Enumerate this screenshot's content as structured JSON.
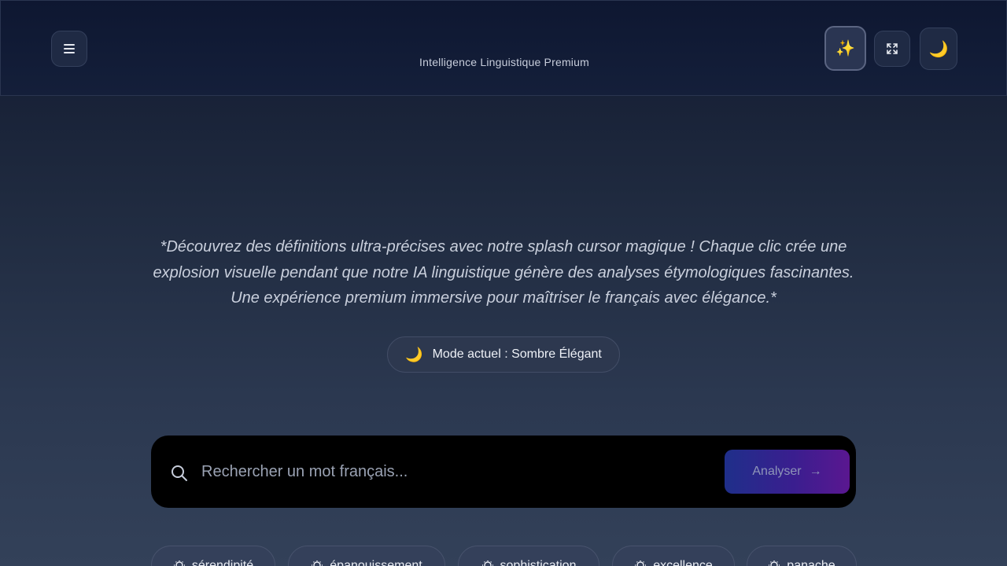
{
  "header": {
    "subtitle": "Intelligence Linguistique Premium",
    "sparkle_icon": "✨",
    "moon_icon": "🌙"
  },
  "hero": {
    "tagline": "*Découvrez des définitions ultra-précises avec notre splash cursor magique ! Chaque clic crée une explosion visuelle pendant que notre IA linguistique génère des analyses étymologiques fascinantes. Une expérience premium immersive pour maîtriser le français avec élégance.*",
    "mode_icon": "🌙",
    "mode_label": "Mode actuel : Sombre Élégant"
  },
  "search": {
    "placeholder": "Rechercher un mot français...",
    "value": "",
    "button_label": "Analyser",
    "button_arrow": "→"
  },
  "suggestions": [
    {
      "label": "sérendipité"
    },
    {
      "label": "épanouissement"
    },
    {
      "label": "sophistication"
    },
    {
      "label": "excellence"
    },
    {
      "label": "panache"
    }
  ],
  "colors": {
    "accent_start": "#1f2f8a",
    "accent_end": "#5a1790",
    "background": "#1f2a3f"
  }
}
